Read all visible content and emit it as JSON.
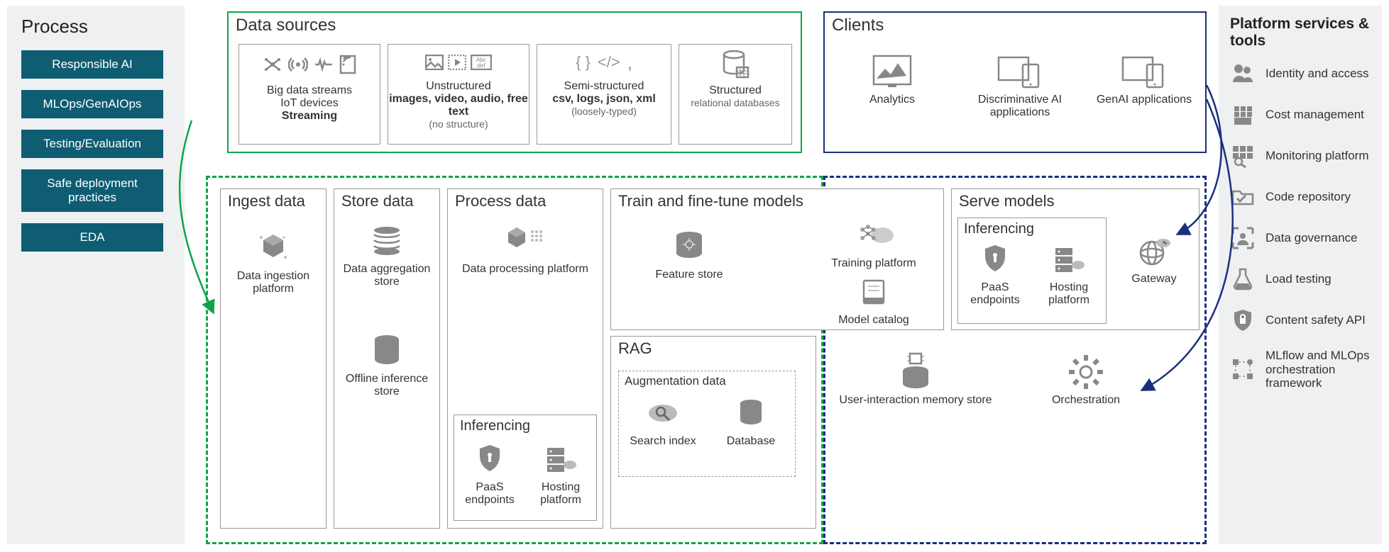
{
  "process": {
    "title": "Process",
    "items": [
      "Responsible AI",
      "MLOps/GenAIOps",
      "Testing/Evaluation",
      "Safe deployment practices",
      "EDA"
    ]
  },
  "platform": {
    "title": "Platform services & tools",
    "items": [
      "Identity and access",
      "Cost management",
      "Monitoring platform",
      "Code repository",
      "Data governance",
      "Load testing",
      "Content safety API",
      "MLflow and MLOps orchestration framework"
    ]
  },
  "dataSources": {
    "title": "Data sources",
    "cards": [
      {
        "line1": "Big data streams",
        "line2": "IoT devices",
        "bold": "Streaming"
      },
      {
        "line1": "Unstructured",
        "bold": "images, video, audio, free text",
        "paren": "(no structure)"
      },
      {
        "line1": "Semi-structured",
        "bold": "csv, logs, json, xml",
        "paren": "(loosely-typed)"
      },
      {
        "line1": "Structured",
        "sub": "relational databases"
      }
    ]
  },
  "clients": {
    "title": "Clients",
    "cards": [
      "Analytics",
      "Discriminative AI applications",
      "GenAI applications"
    ]
  },
  "pipeline": {
    "ingest": {
      "title": "Ingest data",
      "node": "Data ingestion platform"
    },
    "store": {
      "title": "Store data",
      "nodes": [
        "Data aggregation store",
        "Offline inference store"
      ]
    },
    "process": {
      "title": "Process data",
      "node": "Data processing platform",
      "inferencing": {
        "title": "Inferencing",
        "nodes": [
          "PaaS endpoints",
          "Hosting platform"
        ]
      }
    },
    "train": {
      "title": "Train and fine-tune models",
      "nodes": [
        "Feature store",
        "Training platform",
        "Model catalog"
      ]
    },
    "rag": {
      "title": "RAG",
      "aug": {
        "title": "Augmentation data",
        "nodes": [
          "Search index",
          "Database"
        ]
      }
    },
    "serveRow": {
      "memory": "User-interaction memory store",
      "orch": "Orchestration"
    },
    "serve": {
      "title": "Serve models",
      "inferencing": {
        "title": "Inferencing",
        "nodes": [
          "PaaS endpoints",
          "Hosting platform"
        ]
      },
      "gateway": "Gateway"
    }
  }
}
